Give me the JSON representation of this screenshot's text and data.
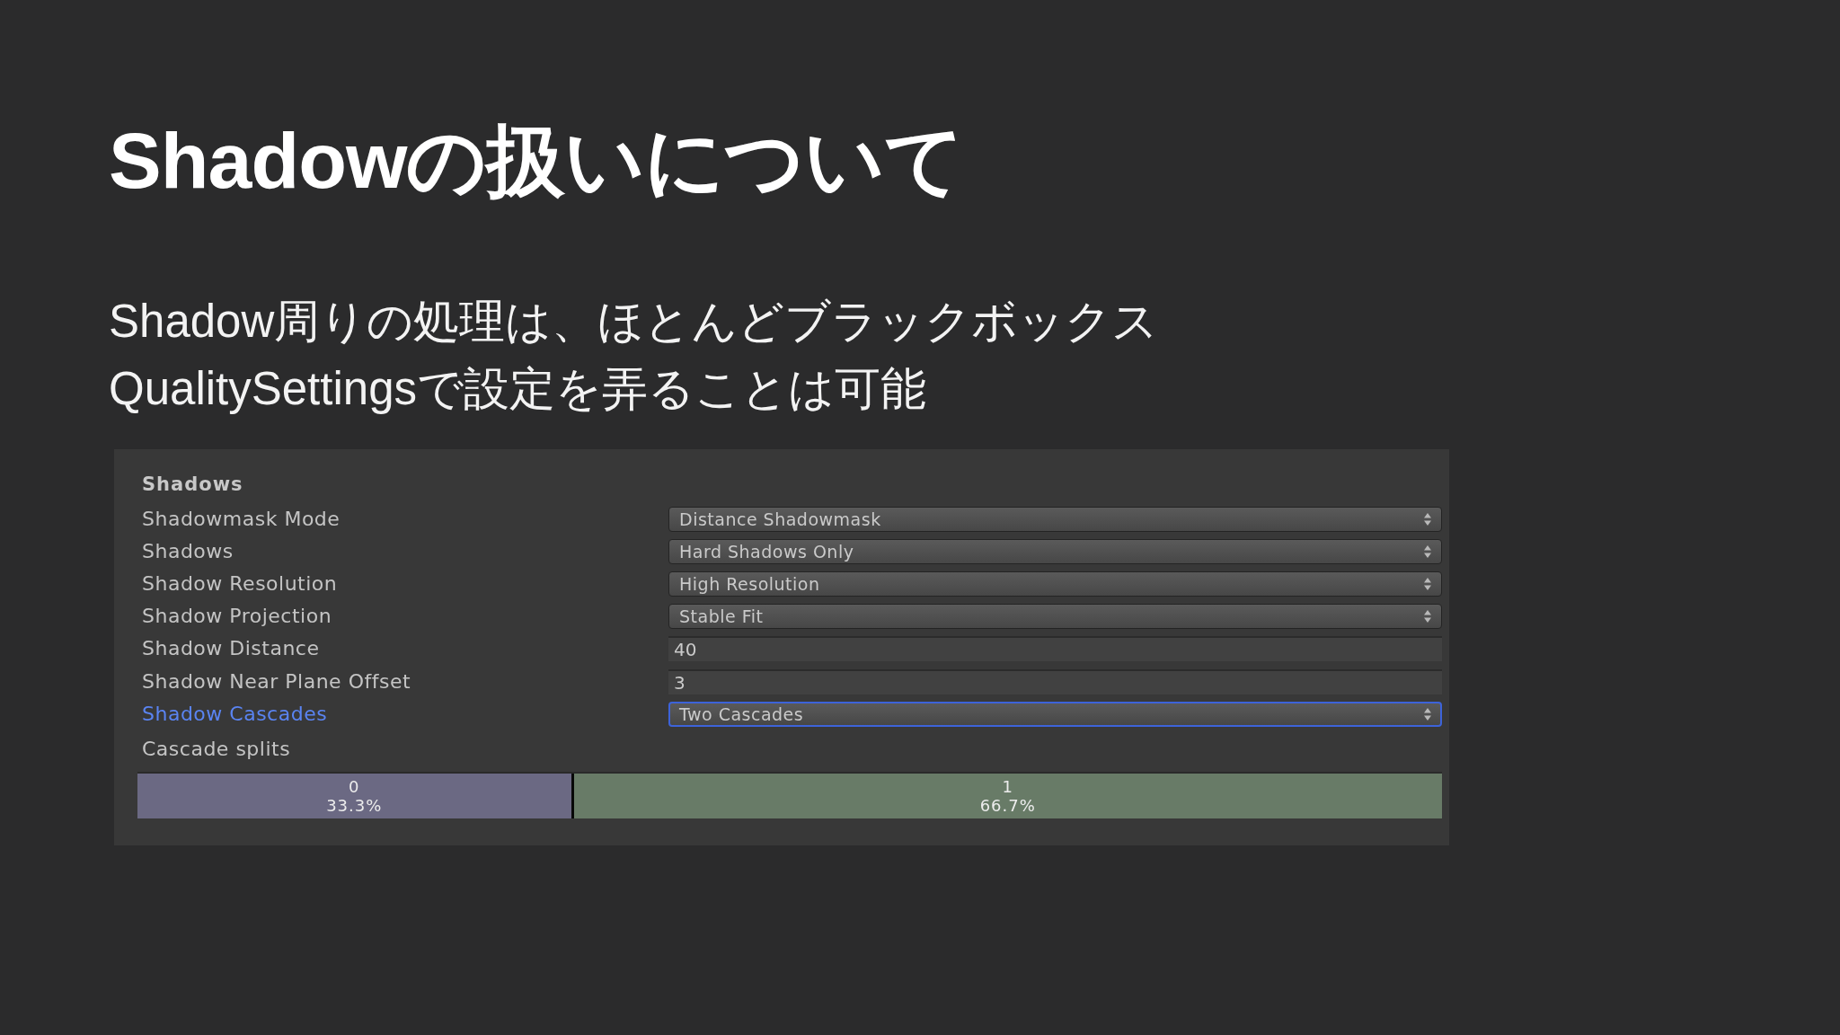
{
  "slide": {
    "title": "Shadowの扱いについて",
    "lines": [
      "Shadow周りの処理は、ほとんどブラックボックス",
      "QualitySettingsで設定を弄ることは可能"
    ]
  },
  "panel": {
    "heading": "Shadows",
    "rows": [
      {
        "label": "Shadowmask Mode",
        "kind": "dropdown",
        "value": "Distance Shadowmask",
        "focused": false
      },
      {
        "label": "Shadows",
        "kind": "dropdown",
        "value": "Hard Shadows Only",
        "focused": false
      },
      {
        "label": "Shadow Resolution",
        "kind": "dropdown",
        "value": "High Resolution",
        "focused": false
      },
      {
        "label": "Shadow Projection",
        "kind": "dropdown",
        "value": "Stable Fit",
        "focused": false
      },
      {
        "label": "Shadow Distance",
        "kind": "field",
        "value": "40",
        "focused": false
      },
      {
        "label": "Shadow Near Plane Offset",
        "kind": "field",
        "value": "3",
        "focused": false
      },
      {
        "label": "Shadow Cascades",
        "kind": "dropdown",
        "value": "Two Cascades",
        "focused": true
      }
    ],
    "cascade_splits": {
      "label": "Cascade splits",
      "segments": [
        {
          "index": "0",
          "percent": "33.3%",
          "level": 0.333,
          "color": "#6b6983"
        },
        {
          "index": "1",
          "percent": "66.7%",
          "level": 0.667,
          "color": "#687b67"
        }
      ]
    }
  }
}
